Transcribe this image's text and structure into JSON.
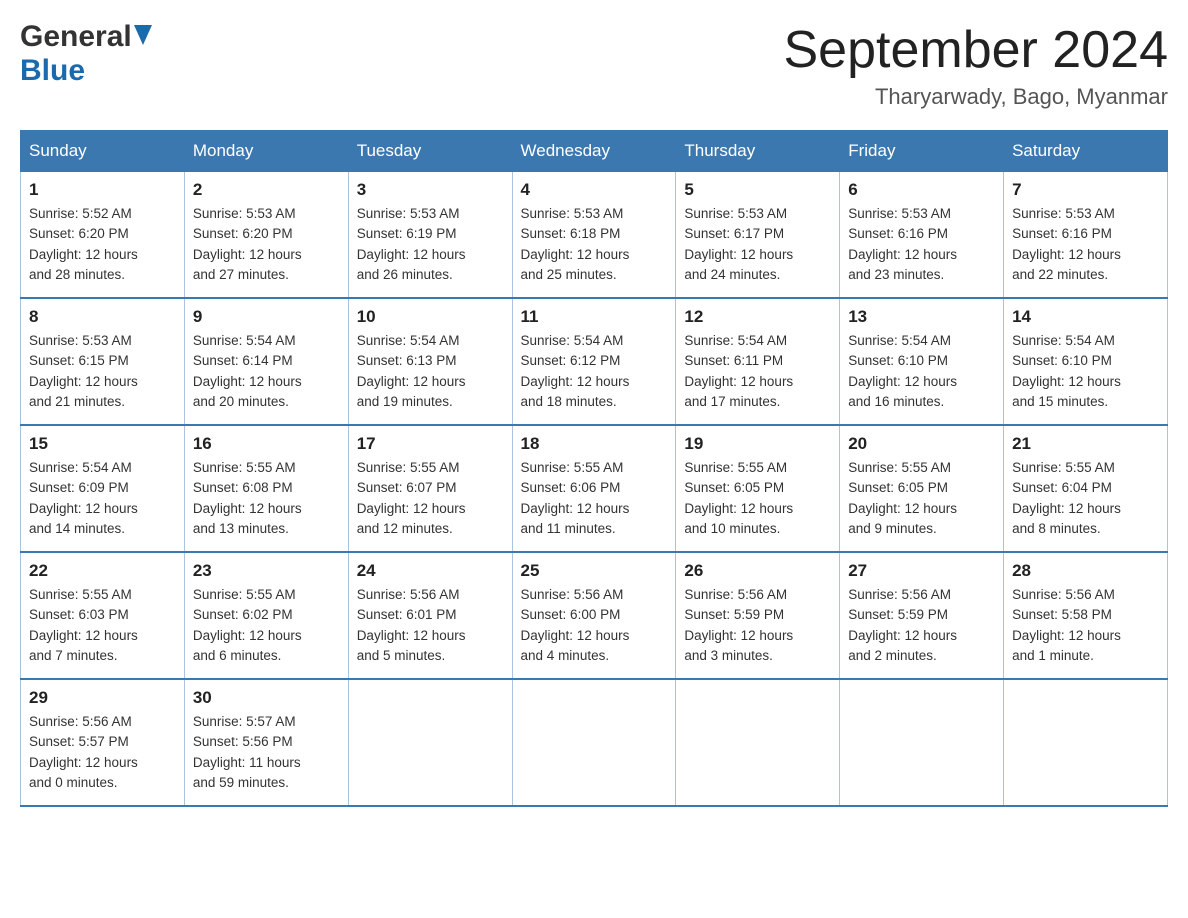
{
  "header": {
    "logo": {
      "general": "General",
      "blue": "Blue"
    },
    "title": "September 2024",
    "location": "Tharyarwady, Bago, Myanmar"
  },
  "days_of_week": [
    "Sunday",
    "Monday",
    "Tuesday",
    "Wednesday",
    "Thursday",
    "Friday",
    "Saturday"
  ],
  "weeks": [
    [
      {
        "day": "1",
        "sunrise": "5:52 AM",
        "sunset": "6:20 PM",
        "daylight_hours": "12",
        "daylight_minutes": "28"
      },
      {
        "day": "2",
        "sunrise": "5:53 AM",
        "sunset": "6:20 PM",
        "daylight_hours": "12",
        "daylight_minutes": "27"
      },
      {
        "day": "3",
        "sunrise": "5:53 AM",
        "sunset": "6:19 PM",
        "daylight_hours": "12",
        "daylight_minutes": "26"
      },
      {
        "day": "4",
        "sunrise": "5:53 AM",
        "sunset": "6:18 PM",
        "daylight_hours": "12",
        "daylight_minutes": "25"
      },
      {
        "day": "5",
        "sunrise": "5:53 AM",
        "sunset": "6:17 PM",
        "daylight_hours": "12",
        "daylight_minutes": "24"
      },
      {
        "day": "6",
        "sunrise": "5:53 AM",
        "sunset": "6:16 PM",
        "daylight_hours": "12",
        "daylight_minutes": "23"
      },
      {
        "day": "7",
        "sunrise": "5:53 AM",
        "sunset": "6:16 PM",
        "daylight_hours": "12",
        "daylight_minutes": "22"
      }
    ],
    [
      {
        "day": "8",
        "sunrise": "5:53 AM",
        "sunset": "6:15 PM",
        "daylight_hours": "12",
        "daylight_minutes": "21"
      },
      {
        "day": "9",
        "sunrise": "5:54 AM",
        "sunset": "6:14 PM",
        "daylight_hours": "12",
        "daylight_minutes": "20"
      },
      {
        "day": "10",
        "sunrise": "5:54 AM",
        "sunset": "6:13 PM",
        "daylight_hours": "12",
        "daylight_minutes": "19"
      },
      {
        "day": "11",
        "sunrise": "5:54 AM",
        "sunset": "6:12 PM",
        "daylight_hours": "12",
        "daylight_minutes": "18"
      },
      {
        "day": "12",
        "sunrise": "5:54 AM",
        "sunset": "6:11 PM",
        "daylight_hours": "12",
        "daylight_minutes": "17"
      },
      {
        "day": "13",
        "sunrise": "5:54 AM",
        "sunset": "6:10 PM",
        "daylight_hours": "12",
        "daylight_minutes": "16"
      },
      {
        "day": "14",
        "sunrise": "5:54 AM",
        "sunset": "6:10 PM",
        "daylight_hours": "12",
        "daylight_minutes": "15"
      }
    ],
    [
      {
        "day": "15",
        "sunrise": "5:54 AM",
        "sunset": "6:09 PM",
        "daylight_hours": "12",
        "daylight_minutes": "14"
      },
      {
        "day": "16",
        "sunrise": "5:55 AM",
        "sunset": "6:08 PM",
        "daylight_hours": "12",
        "daylight_minutes": "13"
      },
      {
        "day": "17",
        "sunrise": "5:55 AM",
        "sunset": "6:07 PM",
        "daylight_hours": "12",
        "daylight_minutes": "12"
      },
      {
        "day": "18",
        "sunrise": "5:55 AM",
        "sunset": "6:06 PM",
        "daylight_hours": "12",
        "daylight_minutes": "11"
      },
      {
        "day": "19",
        "sunrise": "5:55 AM",
        "sunset": "6:05 PM",
        "daylight_hours": "12",
        "daylight_minutes": "10"
      },
      {
        "day": "20",
        "sunrise": "5:55 AM",
        "sunset": "6:05 PM",
        "daylight_hours": "12",
        "daylight_minutes": "9"
      },
      {
        "day": "21",
        "sunrise": "5:55 AM",
        "sunset": "6:04 PM",
        "daylight_hours": "12",
        "daylight_minutes": "8"
      }
    ],
    [
      {
        "day": "22",
        "sunrise": "5:55 AM",
        "sunset": "6:03 PM",
        "daylight_hours": "12",
        "daylight_minutes": "7"
      },
      {
        "day": "23",
        "sunrise": "5:55 AM",
        "sunset": "6:02 PM",
        "daylight_hours": "12",
        "daylight_minutes": "6"
      },
      {
        "day": "24",
        "sunrise": "5:56 AM",
        "sunset": "6:01 PM",
        "daylight_hours": "12",
        "daylight_minutes": "5"
      },
      {
        "day": "25",
        "sunrise": "5:56 AM",
        "sunset": "6:00 PM",
        "daylight_hours": "12",
        "daylight_minutes": "4"
      },
      {
        "day": "26",
        "sunrise": "5:56 AM",
        "sunset": "5:59 PM",
        "daylight_hours": "12",
        "daylight_minutes": "3"
      },
      {
        "day": "27",
        "sunrise": "5:56 AM",
        "sunset": "5:59 PM",
        "daylight_hours": "12",
        "daylight_minutes": "2"
      },
      {
        "day": "28",
        "sunrise": "5:56 AM",
        "sunset": "5:58 PM",
        "daylight_hours": "12",
        "daylight_minutes": "1"
      }
    ],
    [
      {
        "day": "29",
        "sunrise": "5:56 AM",
        "sunset": "5:57 PM",
        "daylight_hours": "12",
        "daylight_minutes": "0"
      },
      {
        "day": "30",
        "sunrise": "5:57 AM",
        "sunset": "5:56 PM",
        "daylight_hours": "11",
        "daylight_minutes": "59"
      },
      null,
      null,
      null,
      null,
      null
    ]
  ],
  "labels": {
    "sunrise": "Sunrise:",
    "sunset": "Sunset:",
    "daylight": "Daylight: 12 hours",
    "and": "and",
    "minutes": "minutes."
  }
}
